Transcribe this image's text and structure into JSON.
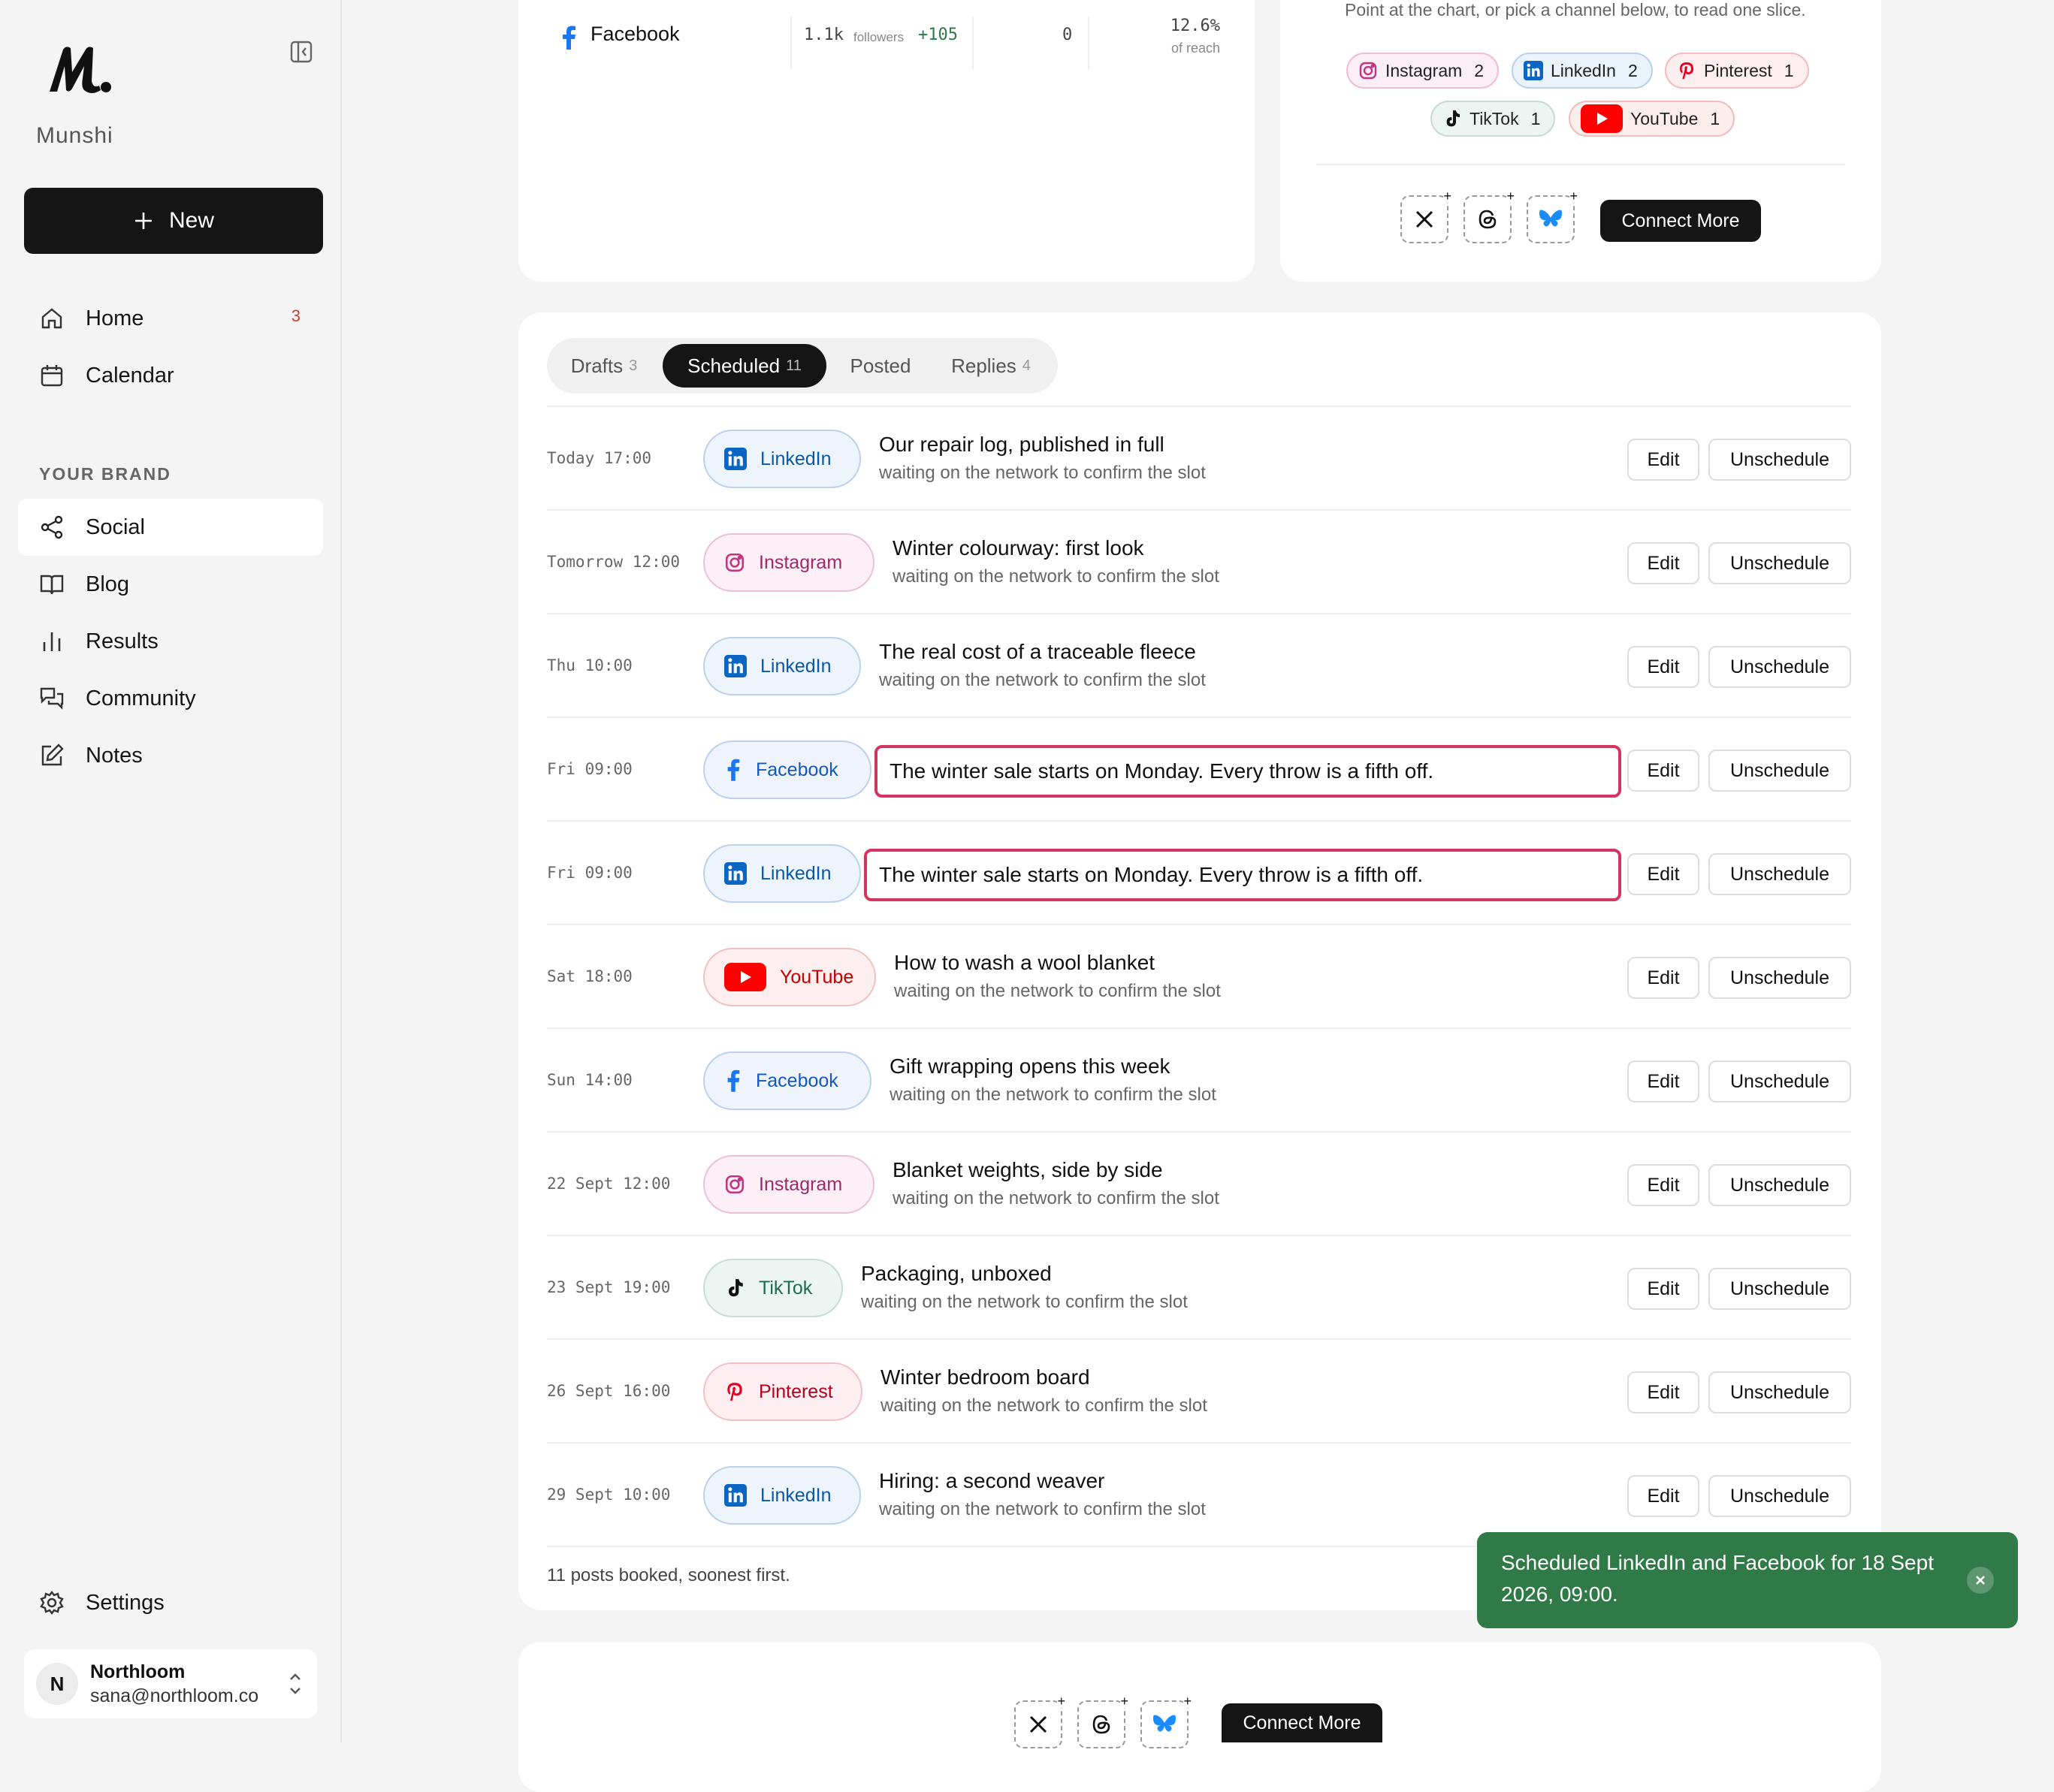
{
  "brand": {
    "name": "Munshi"
  },
  "colors": {
    "linkedin": "#0a66c2",
    "instagram": "#c13584",
    "facebook": "#1877f2",
    "youtube": "#ff0000",
    "tiktok": "#111111",
    "pinterest": "#e60023",
    "highlight": "#d33460",
    "toast": "#2f7a47"
  },
  "sidebar": {
    "new_label": "New",
    "items": [
      {
        "label": "Home",
        "icon": "home-icon",
        "badge": "3"
      },
      {
        "label": "Calendar",
        "icon": "calendar-icon"
      }
    ],
    "section_label": "YOUR BRAND",
    "brand_items": [
      {
        "label": "Social",
        "icon": "share-icon",
        "active": true
      },
      {
        "label": "Blog",
        "icon": "book-icon"
      },
      {
        "label": "Results",
        "icon": "bar-chart-icon"
      },
      {
        "label": "Community",
        "icon": "chat-icon"
      },
      {
        "label": "Notes",
        "icon": "note-edit-icon"
      }
    ],
    "settings_label": "Settings",
    "account": {
      "initial": "N",
      "name": "Northloom",
      "email": "sana@northloom.co"
    }
  },
  "top_left": {
    "network": "Facebook",
    "followers": "1.1k",
    "followers_label": "followers",
    "growth": "+105",
    "count": "0",
    "reach": "12.6%",
    "reach_label": "of reach"
  },
  "top_right": {
    "hint": "Point at the chart, or pick a channel below, to read one slice.",
    "channels": [
      {
        "name": "Instagram",
        "count": "2"
      },
      {
        "name": "LinkedIn",
        "count": "2"
      },
      {
        "name": "Pinterest",
        "count": "1"
      },
      {
        "name": "TikTok",
        "count": "1"
      },
      {
        "name": "YouTube",
        "count": "1"
      }
    ],
    "connect_label": "Connect More"
  },
  "tabs": [
    {
      "label": "Drafts",
      "count": "3"
    },
    {
      "label": "Scheduled",
      "count": "11",
      "active": true
    },
    {
      "label": "Posted",
      "count": ""
    },
    {
      "label": "Replies",
      "count": "4"
    }
  ],
  "row_actions": {
    "edit": "Edit",
    "unschedule": "Unschedule"
  },
  "scheduled": [
    {
      "time": "Today 17:00",
      "network": "LinkedIn",
      "title": "Our repair log, published in full",
      "status": "waiting on the network to confirm the slot"
    },
    {
      "time": "Tomorrow 12:00",
      "network": "Instagram",
      "title": "Winter colourway: first look",
      "status": "waiting on the network to confirm the slot"
    },
    {
      "time": "Thu 10:00",
      "network": "LinkedIn",
      "title": "The real cost of a traceable fleece",
      "status": "waiting on the network to confirm the slot"
    },
    {
      "time": "Fri 09:00",
      "network": "Facebook",
      "title": "The winter sale starts on Monday. Every throw is a fifth off.",
      "editing": true
    },
    {
      "time": "Fri 09:00",
      "network": "LinkedIn",
      "title": "The winter sale starts on Monday. Every throw is a fifth off.",
      "editing": true
    },
    {
      "time": "Sat 18:00",
      "network": "YouTube",
      "title": "How to wash a wool blanket",
      "status": "waiting on the network to confirm the slot"
    },
    {
      "time": "Sun 14:00",
      "network": "Facebook",
      "title": "Gift wrapping opens this week",
      "status": "waiting on the network to confirm the slot"
    },
    {
      "time": "22 Sept 12:00",
      "network": "Instagram",
      "title": "Blanket weights, side by side",
      "status": "waiting on the network to confirm the slot"
    },
    {
      "time": "23 Sept 19:00",
      "network": "TikTok",
      "title": "Packaging, unboxed",
      "status": "waiting on the network to confirm the slot"
    },
    {
      "time": "26 Sept 16:00",
      "network": "Pinterest",
      "title": "Winter bedroom board",
      "status": "waiting on the network to confirm the slot"
    },
    {
      "time": "29 Sept 10:00",
      "network": "LinkedIn",
      "title": "Hiring: a second weaver",
      "status": "waiting on the network to confirm the slot"
    }
  ],
  "footnote": "11 posts booked, soonest first.",
  "toast": {
    "message": "Scheduled LinkedIn and Facebook for 18 Sept 2026, 09:00."
  },
  "bottom": {
    "connect_label": "Connect More"
  }
}
